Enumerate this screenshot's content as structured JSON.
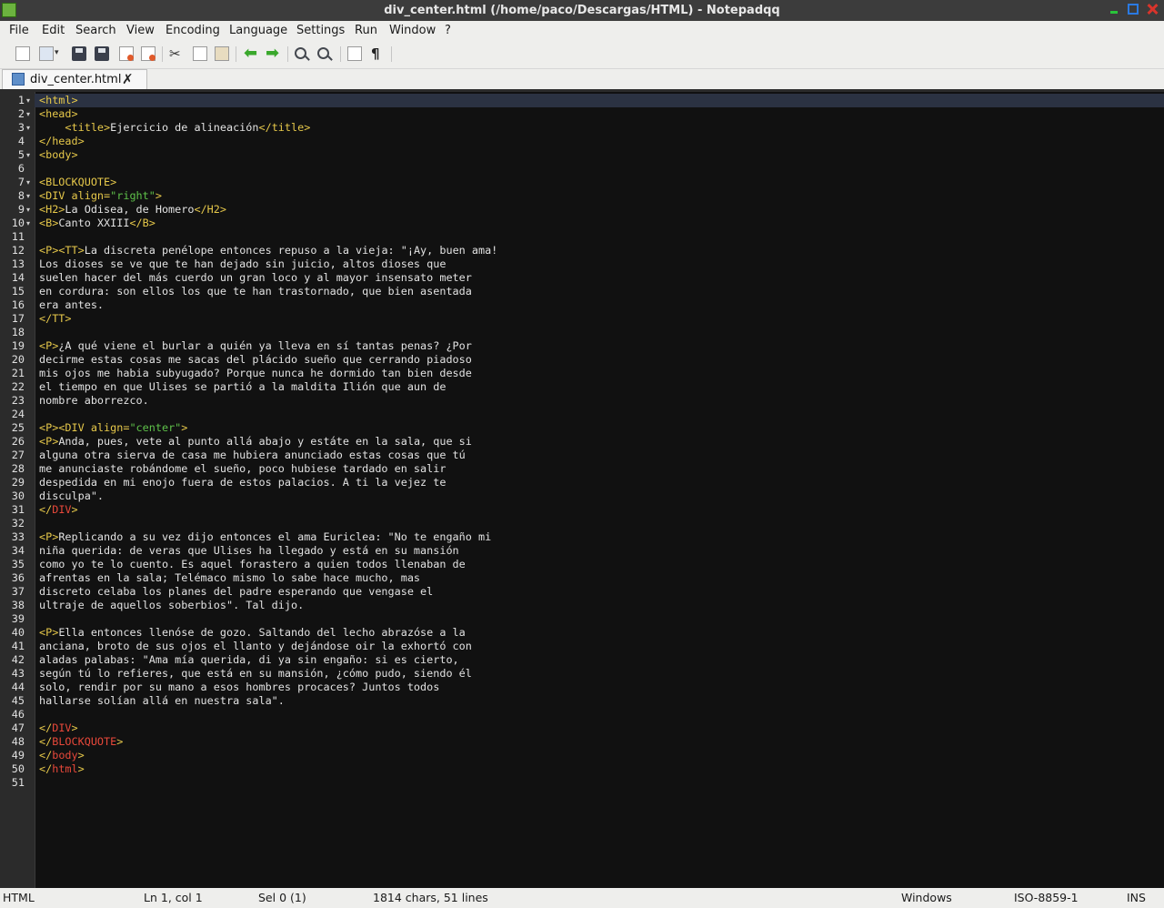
{
  "window": {
    "title": "div_center.html (/home/paco/Descargas/HTML) - Notepadqq"
  },
  "menu": [
    "File",
    "Edit",
    "Search",
    "View",
    "Encoding",
    "Language",
    "Settings",
    "Run",
    "Window",
    "?"
  ],
  "toolbar": [
    "new-file-icon",
    "open-file-icon",
    "save-icon",
    "save-all-icon",
    "close-file-icon",
    "close-all-icon",
    "cut-icon",
    "copy-icon",
    "paste-icon",
    "undo-icon",
    "redo-icon",
    "zoom-in-icon",
    "zoom-out-icon",
    "word-wrap-icon",
    "show-all-chars-icon"
  ],
  "tab": {
    "label": "div_center.html",
    "close": "✗"
  },
  "editor": {
    "current_line": 1,
    "fold_lines": [
      1,
      2,
      3,
      5,
      7,
      8,
      9,
      10
    ],
    "lines": [
      "<html>",
      "<head>",
      "    <title>Ejercicio de alineación</title>",
      "</head>",
      "<body>",
      "",
      "<BLOCKQUOTE>",
      "<DIV align=\"right\">",
      "<H2>La Odisea, de Homero</H2>",
      "<B>Canto XXIII</B>",
      "",
      "<P><TT>La discreta penélope entonces repuso a la vieja: \"¡Ay, buen ama!",
      "Los dioses se ve que te han dejado sin juicio, altos dioses que",
      "suelen hacer del más cuerdo un gran loco y al mayor insensato meter",
      "en cordura: son ellos los que te han trastornado, que bien asentada",
      "era antes.",
      "</TT>",
      "",
      "<P>¿A qué viene el burlar a quién ya lleva en sí tantas penas? ¿Por",
      "decirme estas cosas me sacas del plácido sueño que cerrando piadoso",
      "mis ojos me habia subyugado? Porque nunca he dormido tan bien desde",
      "el tiempo en que Ulises se partió a la maldita Ilión que aun de",
      "nombre aborrezco.",
      "",
      "<P><DIV align=\"center\">",
      "<P>Anda, pues, vete al punto allá abajo y estáte en la sala, que si",
      "alguna otra sierva de casa me hubiera anunciado estas cosas que tú",
      "me anunciaste robándome el sueño, poco hubiese tardado en salir",
      "despedida en mi enojo fuera de estos palacios. A ti la vejez te",
      "disculpa\".",
      "</DIV>",
      "",
      "<P>Replicando a su vez dijo entonces el ama Euriclea: \"No te engaño mi",
      "niña querida: de veras que Ulises ha llegado y está en su mansión",
      "como yo te lo cuento. Es aquel forastero a quien todos llenaban de",
      "afrentas en la sala; Telémaco mismo lo sabe hace mucho, mas",
      "discreto celaba los planes del padre esperando que vengase el",
      "ultraje de aquellos soberbios\". Tal dijo.",
      "",
      "<P>Ella entonces llenóse de gozo. Saltando del lecho abrazóse a la",
      "anciana, broto de sus ojos el llanto y dejándose oir la exhortó con",
      "aladas palabas: \"Ama mía querida, di ya sin engaño: si es cierto,",
      "según tú lo refieres, que está en su mansión, ¿cómo pudo, siendo él",
      "solo, rendir por su mano a esos hombres procaces? Juntos todos",
      "hallarse solían allá en nuestra sala\".",
      "",
      "</DIV>",
      "</BLOCKQUOTE>",
      "</body>",
      "</html>",
      ""
    ]
  },
  "status": {
    "mode": "HTML",
    "position": "Ln 1, col 1",
    "selection": "Sel 0 (1)",
    "counts": "1814 chars, 51 lines",
    "eol": "Windows",
    "encoding": "ISO-8859-1",
    "insert": "INS"
  }
}
